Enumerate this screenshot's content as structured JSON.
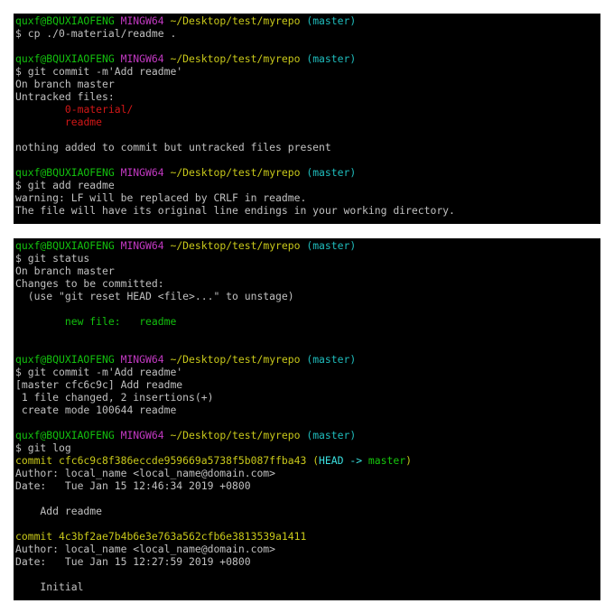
{
  "prompt": {
    "user": "quxf@BQUXIAOFENG",
    "system": "MINGW64",
    "path": "~/Desktop/test/myrepo",
    "branch": "(master)"
  },
  "panel1": {
    "cmd_cp": "$ cp ./0-material/readme .",
    "cmd_commit": "$ git commit -m'Add readme'",
    "on_branch": "On branch master",
    "untracked_header": "Untracked files:",
    "untracked_files": [
      "0-material/",
      "readme"
    ],
    "nothing_added": "nothing added to commit but untracked files present",
    "cmd_add": "$ git add readme",
    "warning_1": "warning: LF will be replaced by CRLF in readme.",
    "warning_2": "The file will have its original line endings in your working directory."
  },
  "panel2": {
    "cmd_status": "$ git status",
    "on_branch": "On branch master",
    "changes_header": "Changes to be committed:",
    "unstage_hint": "  (use \"git reset HEAD <file>...\" to unstage)",
    "new_file_label": "new file:",
    "new_file_name": "readme",
    "cmd_commit": "$ git commit -m'Add readme'",
    "commit_result": "[master cfc6c9c] Add readme",
    "files_changed": " 1 file changed, 2 insertions(+)",
    "create_mode": " create mode 100644 readme",
    "cmd_log": "$ git log",
    "commits": [
      {
        "hash_line": "commit cfc6c9c8f386eccde959669a5738f5b087ffba43",
        "ref_open": "(",
        "ref_head": "HEAD -> ",
        "ref_branch": "master",
        "ref_close": ")",
        "author": "Author: local_name <local_name@domain.com>",
        "date": "Date:   Tue Jan 15 12:46:34 2019 +0800",
        "message": "    Add readme"
      },
      {
        "hash_line": "commit 4c3bf2ae7b4b6e3e763a562cfb6e3813539a1411",
        "author": "Author: local_name <local_name@domain.com>",
        "date": "Date:   Tue Jan 15 12:27:59 2019 +0800",
        "message": "    Initial"
      }
    ]
  },
  "colors": {
    "background": "#000000",
    "text": "#c0c0c0",
    "user_host": "#13c10e",
    "system": "#c239c2",
    "path": "#c8c81a",
    "branch": "#1fbcbc",
    "untracked": "#d21717",
    "staged": "#13c10e"
  }
}
